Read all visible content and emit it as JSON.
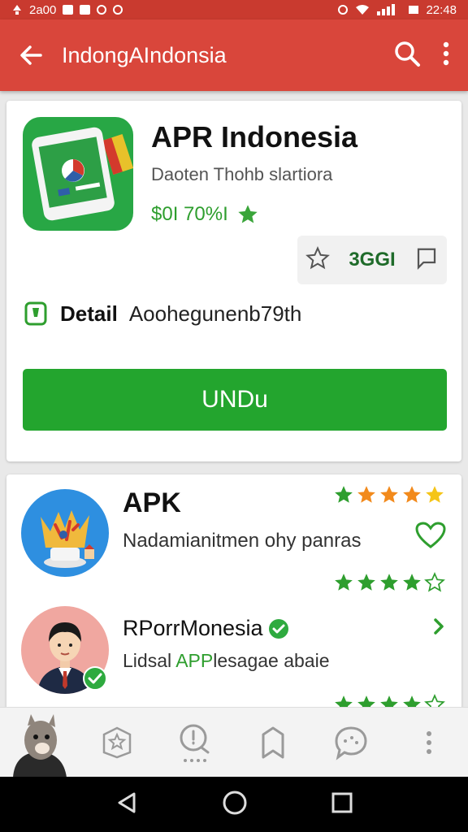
{
  "status_bar": {
    "left_text": "2a00",
    "time": "22:48"
  },
  "app_bar": {
    "title": "IndongAIndonsia",
    "icons": [
      "back-arrow-icon",
      "search-icon",
      "more-vert-icon"
    ]
  },
  "app_card": {
    "name": "APR Indonesia",
    "developer": "Daoten Thohb slartiora",
    "price": "$0I 70%I",
    "rating_count": "3GGI",
    "detail_label": "Detail",
    "detail_value": "Aoohegunenb79th",
    "install_label": "UNDu"
  },
  "list": [
    {
      "title": "APK",
      "subtitle": "Nadamianitmen ohy panras",
      "top_stars": 5,
      "bottom_stars": 4.5
    },
    {
      "title": "RPorrMonesia",
      "subtitle_prefix": "Lidsal ",
      "subtitle_accent": "APP",
      "subtitle_suffix": "lesagae abaie",
      "verified": true
    }
  ],
  "bottom_nav": [
    "profile-avatar",
    "star-badge-icon",
    "search-chat-icon",
    "bookmark-icon",
    "message-icon",
    "more-vert-icon"
  ],
  "colors": {
    "status_bar": "#c93a2f",
    "app_bar": "#d9463b",
    "install_button": "#23a52e",
    "price_green": "#2e9e2e",
    "star_green": "#3aa53a",
    "star_orange": "#f28a1c"
  }
}
